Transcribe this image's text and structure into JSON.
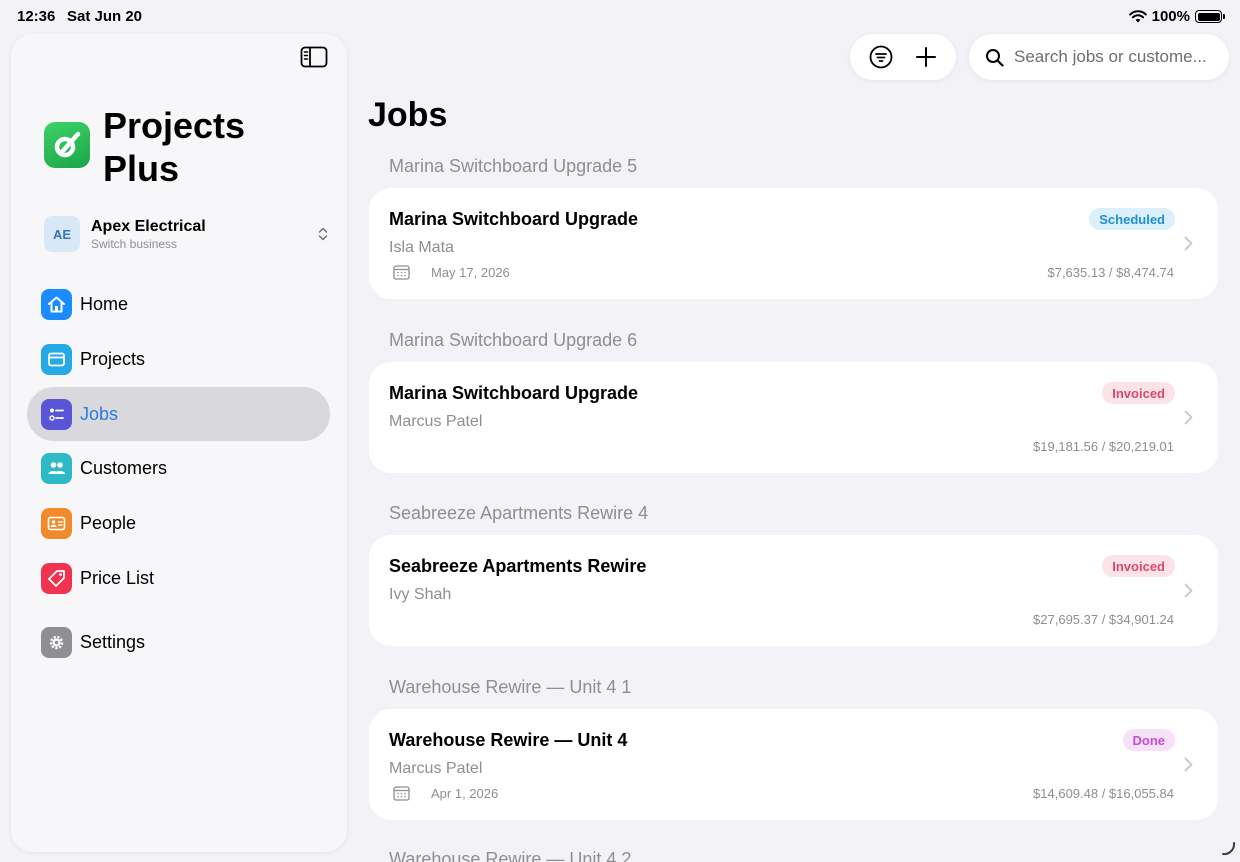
{
  "status_bar": {
    "time": "12:36",
    "date": "Sat Jun 20",
    "battery": "100%"
  },
  "sidebar": {
    "app_name": "Projects Plus",
    "account": {
      "initials": "AE",
      "name": "Apex Electrical",
      "subtitle": "Switch business"
    },
    "items": [
      {
        "label": "Home",
        "icon": "house-icon",
        "color": "#1a8cff",
        "active": false
      },
      {
        "label": "Projects",
        "icon": "folder-icon",
        "color": "#27a9e6",
        "active": false
      },
      {
        "label": "Jobs",
        "icon": "checklist-icon",
        "color": "#5856d6",
        "active": true
      },
      {
        "label": "Customers",
        "icon": "people-icon",
        "color": "#2dbac6",
        "active": false
      },
      {
        "label": "People",
        "icon": "id-card-icon",
        "color": "#f08a2a",
        "active": false
      },
      {
        "label": "Price List",
        "icon": "tag-icon",
        "color": "#f0344f",
        "active": false
      },
      {
        "label": "Settings",
        "icon": "gear-icon",
        "color": "#8e8e93",
        "active": false
      }
    ]
  },
  "toolbar": {
    "filter_icon": "filter-icon",
    "add_icon": "plus-icon",
    "search_placeholder": "Search jobs or custome..."
  },
  "main": {
    "title": "Jobs",
    "sections": [
      {
        "header": "Marina Switchboard Upgrade 5",
        "job": {
          "title": "Marina Switchboard Upgrade",
          "customer": "Isla Mata",
          "date": "May 17, 2026",
          "status": "Scheduled",
          "status_color": "#1f8fd6",
          "status_bg": "#dcf0fb",
          "amount": "$7,635.13 / $8,474.74"
        }
      },
      {
        "header": "Marina Switchboard Upgrade 6",
        "job": {
          "title": "Marina Switchboard Upgrade",
          "customer": "Marcus Patel",
          "date": "",
          "status": "Invoiced",
          "status_color": "#d94a6a",
          "status_bg": "#fbe3e8",
          "amount": "$19,181.56 / $20,219.01"
        }
      },
      {
        "header": "Seabreeze Apartments Rewire 4",
        "job": {
          "title": "Seabreeze Apartments Rewire",
          "customer": "Ivy Shah",
          "date": "",
          "status": "Invoiced",
          "status_color": "#d94a6a",
          "status_bg": "#fbe3e8",
          "amount": "$27,695.37 / $34,901.24"
        }
      },
      {
        "header": "Warehouse Rewire — Unit 4 1",
        "job": {
          "title": "Warehouse Rewire — Unit 4",
          "customer": "Marcus Patel",
          "date": "Apr 1, 2026",
          "status": "Done",
          "status_color": "#c54cd4",
          "status_bg": "#f7e1f9",
          "amount": "$14,609.48 / $16,055.84"
        }
      },
      {
        "header": "Warehouse Rewire — Unit 4 2",
        "job": null
      }
    ]
  }
}
